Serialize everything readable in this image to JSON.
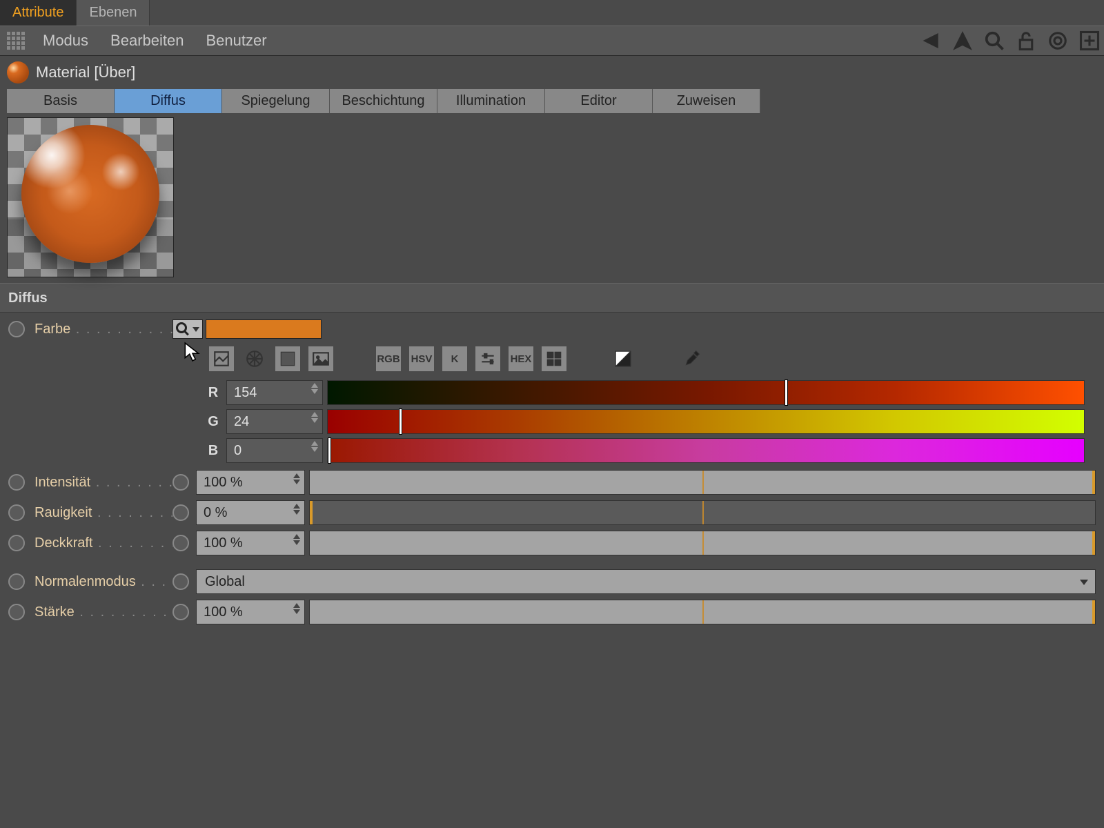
{
  "top_tabs": {
    "attribute": "Attribute",
    "ebenen": "Ebenen"
  },
  "menu": {
    "modus": "Modus",
    "bearbeiten": "Bearbeiten",
    "benutzer": "Benutzer"
  },
  "material": {
    "title": "Material [Über]"
  },
  "channels": {
    "basis": "Basis",
    "diffus": "Diffus",
    "spiegelung": "Spiegelung",
    "beschichtung": "Beschichtung",
    "illumination": "Illumination",
    "editor": "Editor",
    "zuweisen": "Zuweisen"
  },
  "section": {
    "title": "Diffus"
  },
  "labels": {
    "farbe": "Farbe",
    "intensitaet": "Intensität",
    "rauigkeit": "Rauigkeit",
    "deckkraft": "Deckkraft",
    "normalenmodus": "Normalenmodus",
    "staerke": "Stärke"
  },
  "color": {
    "swatch_hex": "#da7a1e",
    "mode_buttons": {
      "rgb": "RGB",
      "hsv": "HSV",
      "k": "K",
      "hex": "HEX"
    },
    "r": {
      "label": "R",
      "value": "154",
      "pct": 60.4
    },
    "g": {
      "label": "G",
      "value": "24",
      "pct": 9.4
    },
    "b": {
      "label": "B",
      "value": "0",
      "pct": 0.0
    }
  },
  "values": {
    "intensitaet": "100 %",
    "rauigkeit": "0 %",
    "deckkraft": "100 %",
    "normalenmodus": "Global",
    "staerke": "100 %"
  },
  "slider_pct": {
    "intensitaet": 100,
    "rauigkeit": 0,
    "deckkraft": 100,
    "staerke": 100
  }
}
